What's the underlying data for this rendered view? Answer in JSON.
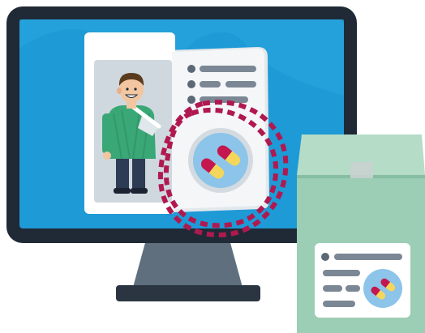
{
  "illustration": {
    "subject": "online-pharmacy-prescription",
    "icons": [
      "desktop-monitor-icon",
      "prescription-card-icon",
      "doctor-avatar-icon",
      "capsule-pill-icon",
      "pharmacy-paper-bag-icon"
    ]
  },
  "colors": {
    "monitor_frame": "#1f2a36",
    "screen_blue": "#1e9ad6",
    "screen_blue_dark": "#1680b6",
    "card_white": "#ffffff",
    "card_shade": "#d9dfe4",
    "photo_bg": "#cfd8de",
    "doctor_coat_green": "#3aa776",
    "doctor_skin": "#f2c6a0",
    "doctor_hair": "#5a3b1e",
    "pants_navy": "#2d3b55",
    "text_line_gray": "#7b8794",
    "dashed_outline_crimson": "#b0194f",
    "pill_circle_blue": "#8cc4ea",
    "pill_red": "#c4174f",
    "pill_yellow": "#f4d65a",
    "bag_green": "#9ccdb5",
    "bag_green_light": "#b5dcc7",
    "tape_gray": "#c9d1cf",
    "stand_gray": "#5f6f7e",
    "base_dark": "#2a3541"
  }
}
